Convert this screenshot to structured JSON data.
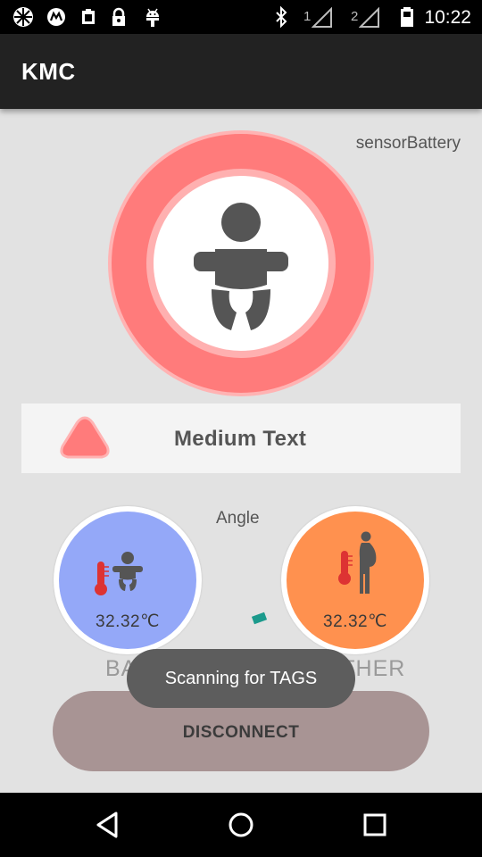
{
  "status_bar": {
    "time": "10:22",
    "left_icons": [
      "settings-flower-icon",
      "motorola-icon",
      "clipboard-icon",
      "lock-icon",
      "android-icon"
    ],
    "right_icons": [
      "bluetooth-icon",
      "signal-sim1-icon",
      "signal-sim2-icon",
      "battery-icon"
    ],
    "sim1_label": "1",
    "sim2_label": "2"
  },
  "app_bar": {
    "title": "KMC"
  },
  "sensor_battery": {
    "label": "sensorBattery"
  },
  "main_indicator": {
    "icon": "baby-icon",
    "ring_color": "#ff7b7b",
    "center_color": "#ffffff"
  },
  "status_bar_info": {
    "text": "Medium Text",
    "icon": "warning-triangle-icon",
    "icon_color": "#ff7b7b"
  },
  "angle": {
    "label": "Angle"
  },
  "baby": {
    "temperature": "32.32℃",
    "caption": "BABY",
    "color": "#94a8f8",
    "icons": [
      "thermometer-icon",
      "baby-icon"
    ]
  },
  "mother": {
    "temperature": "32.32℃",
    "caption": "MOTHER",
    "color": "#ff914f",
    "icons": [
      "thermometer-icon",
      "pregnant-woman-icon"
    ]
  },
  "disconnect_button": {
    "label": "DISCONNECT"
  },
  "toast": {
    "message": "Scanning for TAGS"
  },
  "nav_bar": {
    "buttons": [
      "back-icon",
      "home-icon",
      "recents-icon"
    ]
  }
}
